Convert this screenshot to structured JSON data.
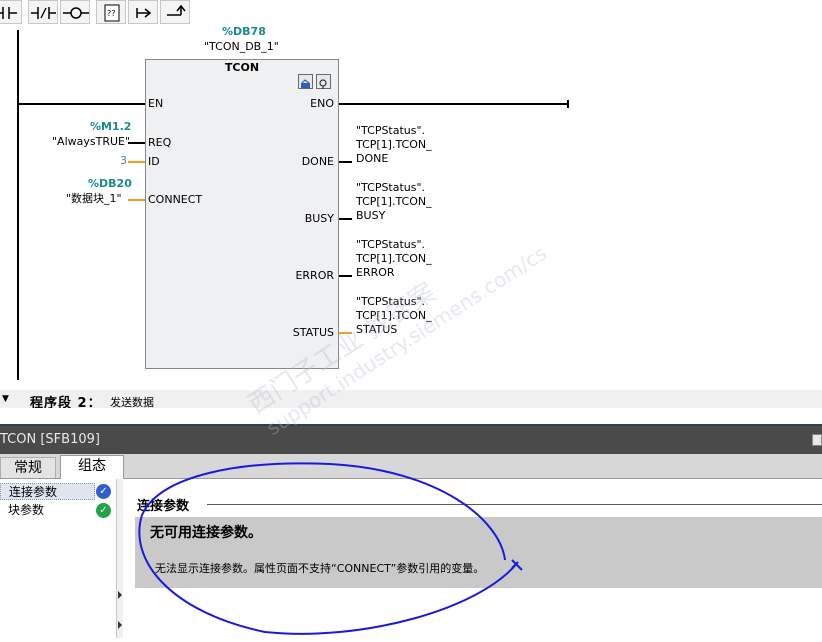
{
  "toolbar": {
    "buttons": [
      {
        "icon": "no-contact-icon",
        "label": "⊣⊢"
      },
      {
        "icon": "nc-contact-icon",
        "label": "⊣/⊢"
      },
      {
        "icon": "coil-icon",
        "label": "–o–"
      },
      {
        "icon": "empty-box-icon",
        "label": "??"
      },
      {
        "icon": "open-branch-icon",
        "label": "↦"
      },
      {
        "icon": "close-branch-icon",
        "label": "↱"
      }
    ]
  },
  "network1": {
    "instance_address": "%DB78",
    "instance_name": "\"TCON_DB_1\"",
    "block": {
      "title": "TCON",
      "inputs": [
        "EN",
        "REQ",
        "ID",
        "CONNECT"
      ],
      "outputs": [
        "ENO",
        "DONE",
        "BUSY",
        "ERROR",
        "STATUS"
      ]
    },
    "req_address": "%M1.2",
    "req_symbol": "\"AlwaysTRUE\"",
    "id_value": "3",
    "connect_address": "%DB20",
    "connect_symbol": "\"数据块_1\"",
    "done_tag": [
      "\"TCPStatus\".",
      "TCP[1].TCON_",
      "DONE"
    ],
    "busy_tag": [
      "\"TCPStatus\".",
      "TCP[1].TCON_",
      "BUSY"
    ],
    "error_tag": [
      "\"TCPStatus\".",
      "TCP[1].TCON_",
      "ERROR"
    ],
    "status_tag": [
      "\"TCPStatus\".",
      "TCP[1].TCON_",
      "STATUS"
    ]
  },
  "network2": {
    "title": "程序段 2：",
    "description": "发送数据"
  },
  "inspector": {
    "title": "TCON [SFB109]",
    "tabs": [
      "常规",
      "组态"
    ],
    "active_tab": "组态",
    "nav_items": [
      {
        "label": "连接参数",
        "status": "check-blue"
      },
      {
        "label": "块参数",
        "status": "check-green"
      }
    ],
    "section_heading": "连接参数",
    "info_title": "无可用连接参数。",
    "info_text": "无法显示连接参数。属性页面不支持“CONNECT”参数引用的变量。"
  },
  "watermark": {
    "line1": "西门子工业   找答案",
    "line2": "support.industry.siemens.com/cs"
  },
  "colors": {
    "teal_address": "#1a8c8c",
    "inspector_bar": "#4a4a4a",
    "annotation": "#1a1adc"
  }
}
